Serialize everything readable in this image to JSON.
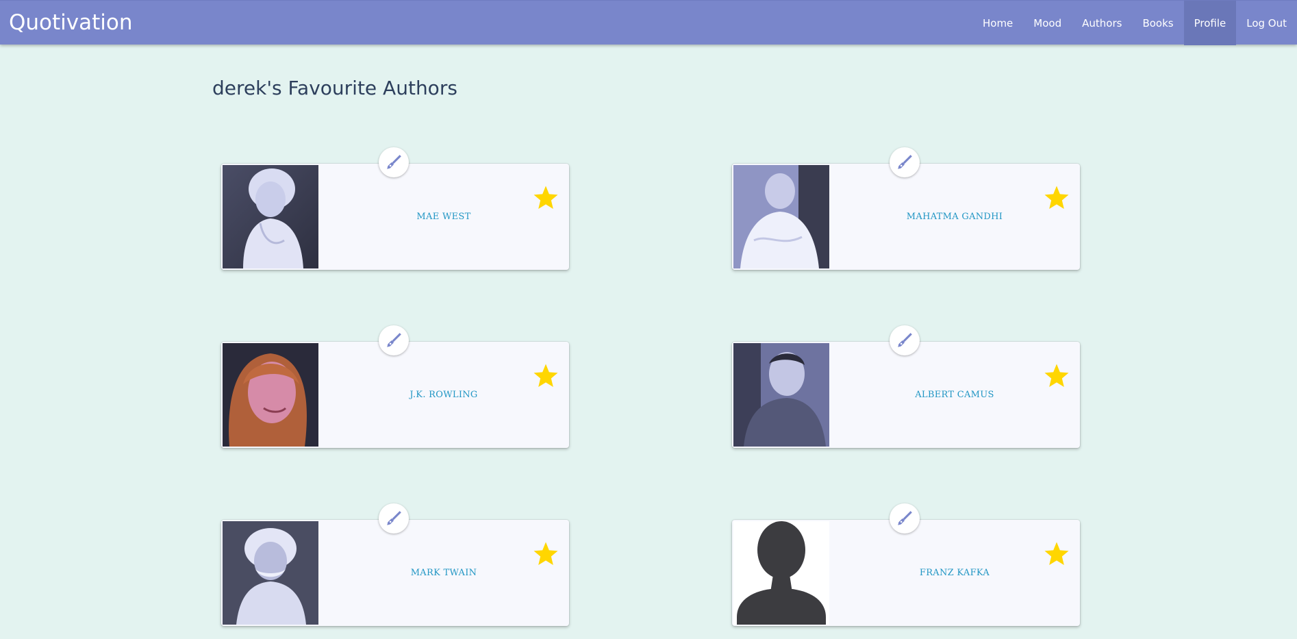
{
  "app": {
    "brand": "Quotivation"
  },
  "nav": {
    "items": [
      {
        "label": "Home",
        "active": false
      },
      {
        "label": "Mood",
        "active": false
      },
      {
        "label": "Authors",
        "active": false
      },
      {
        "label": "Books",
        "active": false
      },
      {
        "label": "Profile",
        "active": true
      },
      {
        "label": "Log Out",
        "active": false
      }
    ]
  },
  "page": {
    "title": "derek's Favourite Authors"
  },
  "authors": [
    {
      "name": "MAE WEST",
      "photo": "portrait-photo",
      "favourite": true
    },
    {
      "name": "MAHATMA GANDHI",
      "photo": "portrait-photo",
      "favourite": true
    },
    {
      "name": "J.K. ROWLING",
      "photo": "portrait-photo",
      "favourite": true
    },
    {
      "name": "ALBERT CAMUS",
      "photo": "portrait-photo",
      "favourite": true
    },
    {
      "name": "MARK TWAIN",
      "photo": "portrait-photo",
      "favourite": true
    },
    {
      "name": "FRANZ KAFKA",
      "photo": "default-avatar",
      "favourite": true
    }
  ],
  "colors": {
    "navbar": "#7986cb",
    "navbar_active": "#6a77b8",
    "background": "#e3f3f0",
    "author_name": "#2196c4",
    "star": "#ffd600",
    "pen_icon": "#7986cb"
  },
  "icons": {
    "favourite": "star-icon",
    "author_badge": "fountain-pen-icon"
  }
}
